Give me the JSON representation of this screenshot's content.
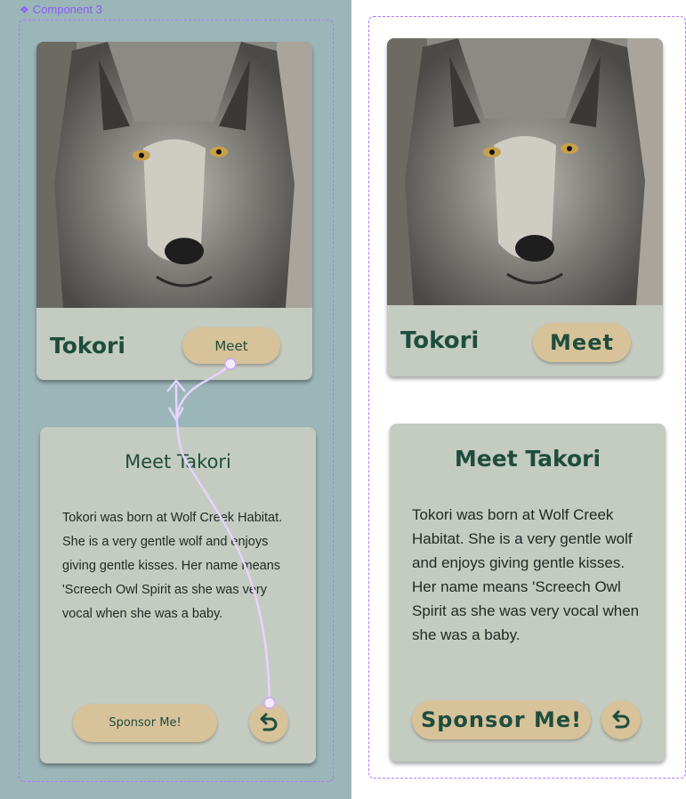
{
  "component": {
    "label": "Component 3"
  },
  "colors": {
    "accent": "#a77bff",
    "pill": "#d7c29a",
    "card": "#c4cbc0",
    "text": "#1e4d3d",
    "canvas": "#9bb6b9"
  },
  "profile": {
    "name": "Tokori",
    "meet_label": "Meet",
    "photo_icon": "wolf-photo"
  },
  "details": {
    "title": "Meet Takori",
    "description": "Tokori was born at Wolf Creek Habitat. She is a very gentle wolf and enjoys giving gentle kisses. Her name means 'Screech Owl Spirit as she was very vocal when she was a baby.",
    "sponsor_label": "Sponsor Me!",
    "back_icon": "undo-arrow-icon"
  }
}
